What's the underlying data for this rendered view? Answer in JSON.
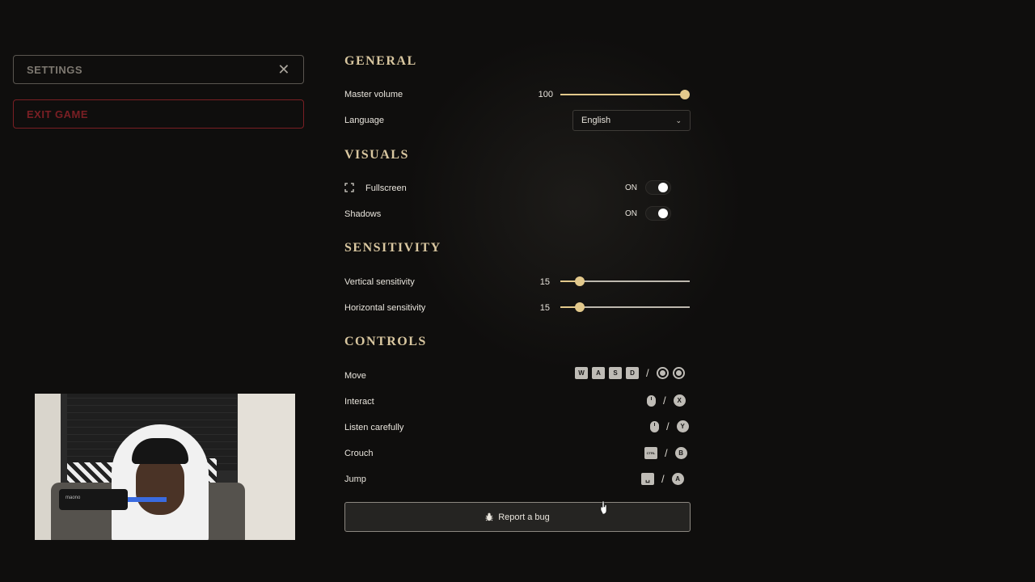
{
  "menu": {
    "settings_label": "SETTINGS",
    "close_glyph": "✕",
    "exit_label": "EXIT GAME"
  },
  "general": {
    "title": "GENERAL",
    "master_volume": {
      "label": "Master volume",
      "value": "100",
      "fraction": 1.0
    },
    "language": {
      "label": "Language",
      "selected": "English"
    }
  },
  "visuals": {
    "title": "VISUALS",
    "fullscreen": {
      "label": "Fullscreen",
      "state": "ON",
      "icon": "fullscreen-icon"
    },
    "shadows": {
      "label": "Shadows",
      "state": "ON"
    }
  },
  "sensitivity": {
    "title": "SENSITIVITY",
    "vertical": {
      "label": "Vertical sensitivity",
      "value": "15",
      "fraction": 0.15
    },
    "horizontal": {
      "label": "Horizontal sensitivity",
      "value": "15",
      "fraction": 0.15
    }
  },
  "controls": {
    "title": "CONTROLS",
    "move": {
      "label": "Move",
      "keys": [
        "W",
        "A",
        "S",
        "D"
      ]
    },
    "interact": {
      "label": "Interact",
      "pad": "X"
    },
    "listen": {
      "label": "Listen carefully",
      "pad": "Y"
    },
    "crouch": {
      "label": "Crouch",
      "key": "CTRL",
      "pad": "B"
    },
    "jump": {
      "label": "Jump",
      "key": "␣",
      "pad": "A"
    },
    "slash": "/"
  },
  "report": {
    "label": "Report a bug"
  },
  "webcam": {
    "mic_brand": "maono"
  },
  "colors": {
    "accent": "#e3c98c",
    "section_title": "#d9c7a0",
    "exit": "#7a1f24",
    "background": "#0f0e0d"
  }
}
